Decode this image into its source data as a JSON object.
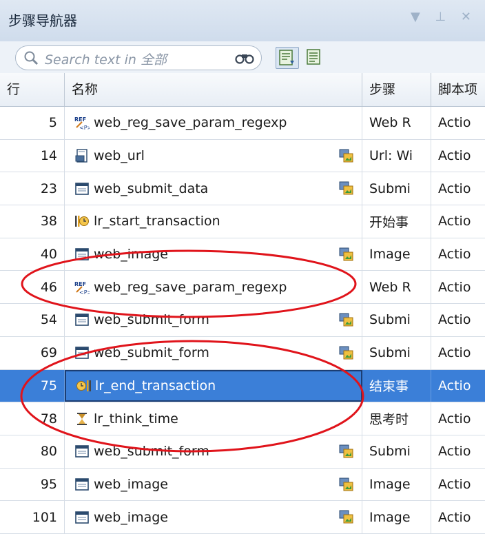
{
  "panel": {
    "title": "步骤导航器",
    "controls": "▼ ⊥ ✕"
  },
  "toolbar": {
    "search_placeholder": "Search text in 全部"
  },
  "columns": {
    "line": "行",
    "name": "名称",
    "step": "步骤",
    "script": "脚本项"
  },
  "rows": [
    {
      "line": "5",
      "name": "web_reg_save_param_regexp",
      "step": "Web R",
      "script": "Actio",
      "icon": "regex-icon",
      "res": false
    },
    {
      "line": "14",
      "name": "web_url",
      "step": "Url: Wi",
      "script": "Actio",
      "icon": "url-page-icon",
      "res": true
    },
    {
      "line": "23",
      "name": "web_submit_data",
      "step": "Submi",
      "script": "Actio",
      "icon": "window-icon",
      "res": true
    },
    {
      "line": "38",
      "name": "lr_start_transaction",
      "step": "开始事",
      "script": "Actio",
      "icon": "transaction-start-icon",
      "res": false
    },
    {
      "line": "40",
      "name": "web_image",
      "step": "Image",
      "script": "Actio",
      "icon": "window-icon",
      "res": true
    },
    {
      "line": "46",
      "name": "web_reg_save_param_regexp",
      "step": "Web R",
      "script": "Actio",
      "icon": "regex-icon",
      "res": false
    },
    {
      "line": "54",
      "name": "web_submit_form",
      "step": "Submi",
      "script": "Actio",
      "icon": "window-icon",
      "res": true
    },
    {
      "line": "69",
      "name": "web_submit_form",
      "step": "Submi",
      "script": "Actio",
      "icon": "window-icon",
      "res": true
    },
    {
      "line": "75",
      "name": "lr_end_transaction",
      "step": "结束事",
      "script": "Actio",
      "icon": "transaction-end-icon",
      "res": false,
      "selected": true
    },
    {
      "line": "78",
      "name": "lr_think_time",
      "step": "思考时",
      "script": "Actio",
      "icon": "hourglass-icon",
      "res": false
    },
    {
      "line": "80",
      "name": "web_submit_form",
      "step": "Submi",
      "script": "Actio",
      "icon": "window-icon",
      "res": true
    },
    {
      "line": "95",
      "name": "web_image",
      "step": "Image",
      "script": "Actio",
      "icon": "window-icon",
      "res": true
    },
    {
      "line": "101",
      "name": "web_image",
      "step": "Image",
      "script": "Actio",
      "icon": "window-icon",
      "res": true
    }
  ],
  "colors": {
    "selected_row": "#3b7fd8",
    "annotation": "#e0141b"
  }
}
